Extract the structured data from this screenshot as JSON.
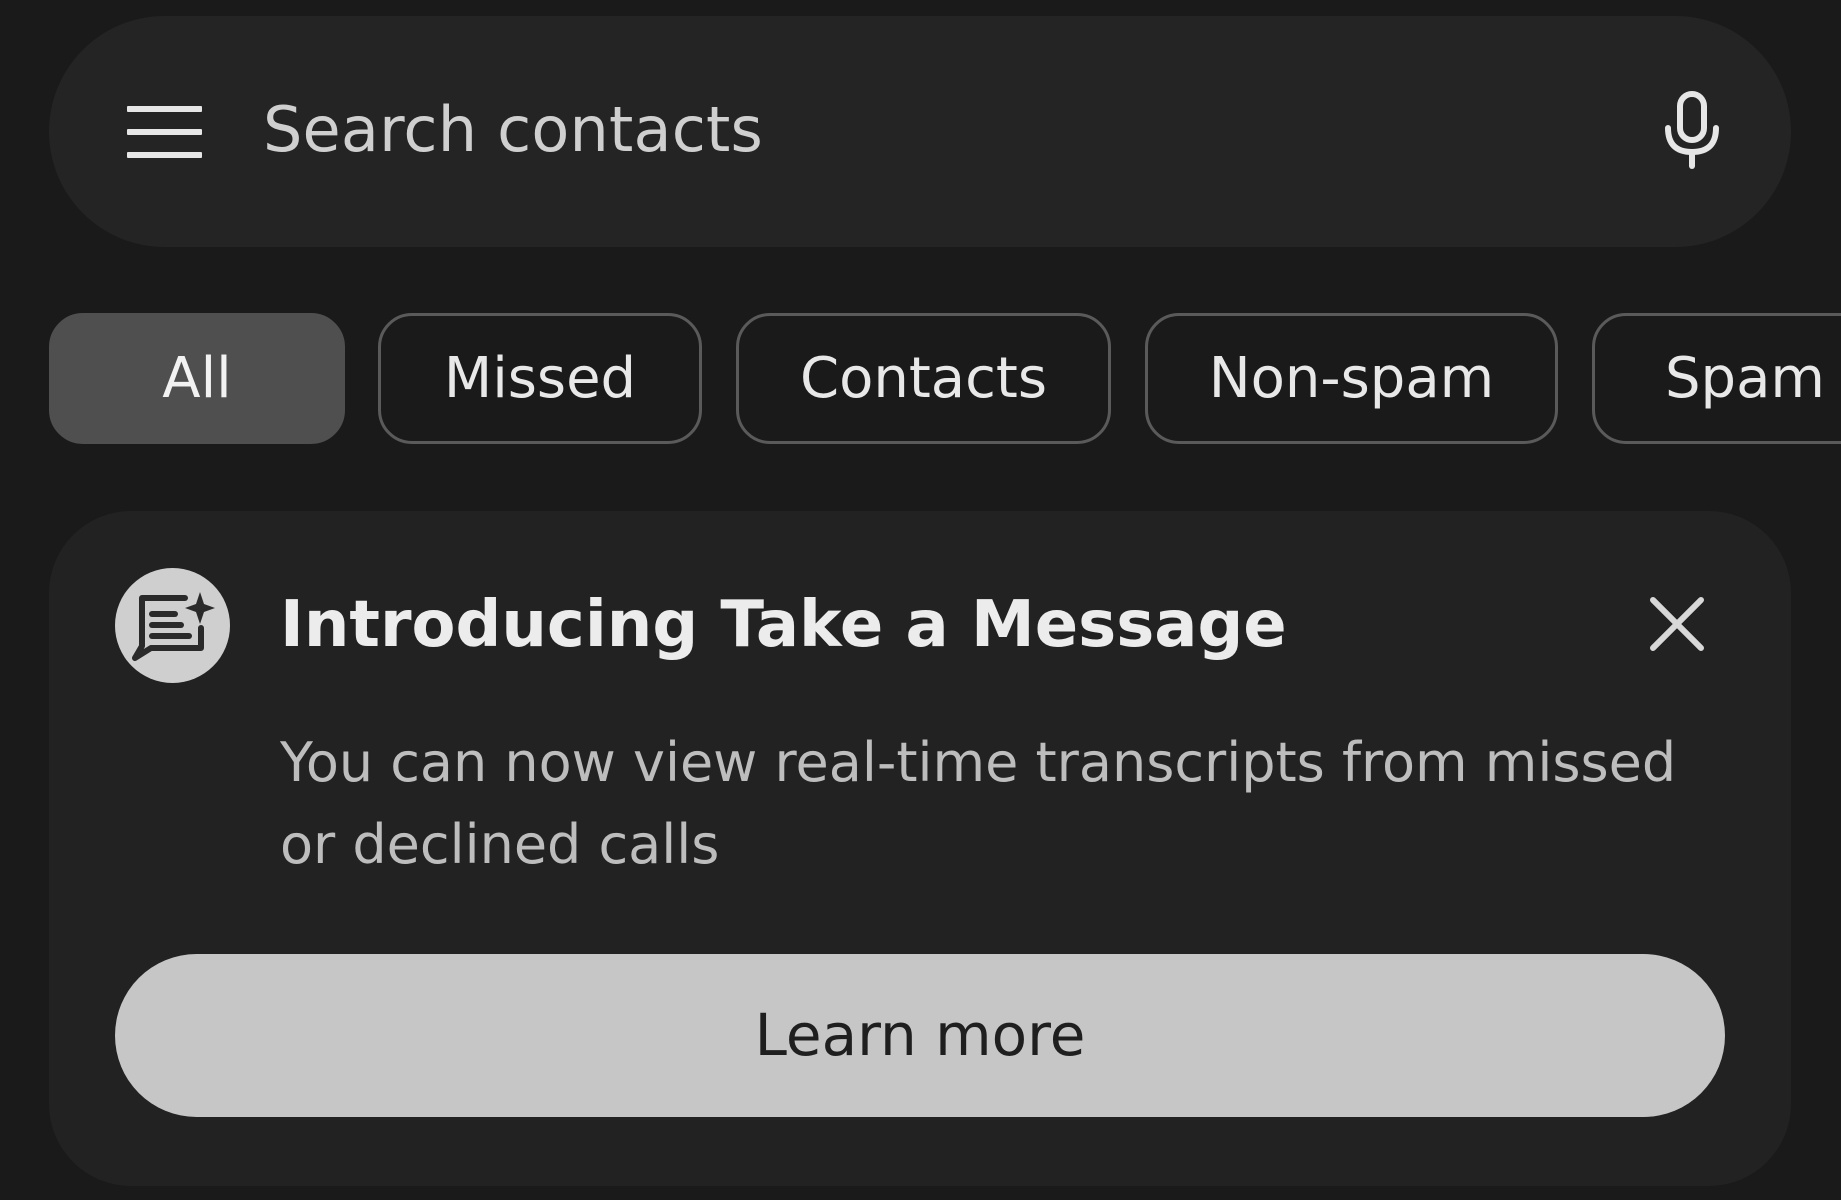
{
  "search": {
    "placeholder": "Search contacts",
    "menu_icon": "hamburger-menu-icon",
    "mic_icon": "microphone-icon"
  },
  "filters": {
    "selected": "All",
    "chips": [
      {
        "label": "All"
      },
      {
        "label": "Missed"
      },
      {
        "label": "Contacts"
      },
      {
        "label": "Non-spam"
      },
      {
        "label": "Spam"
      }
    ]
  },
  "promo_card": {
    "icon": "message-sparkle-icon",
    "title": "Introducing Take a Message",
    "body": "You can now view real-time transcripts from missed or declined calls",
    "close_icon": "close-icon",
    "button_label": "Learn more"
  },
  "colors": {
    "background": "#1a1a1a",
    "surface": "#242424",
    "chip_selected": "#4f4f4f",
    "button": "#c6c6c6"
  }
}
